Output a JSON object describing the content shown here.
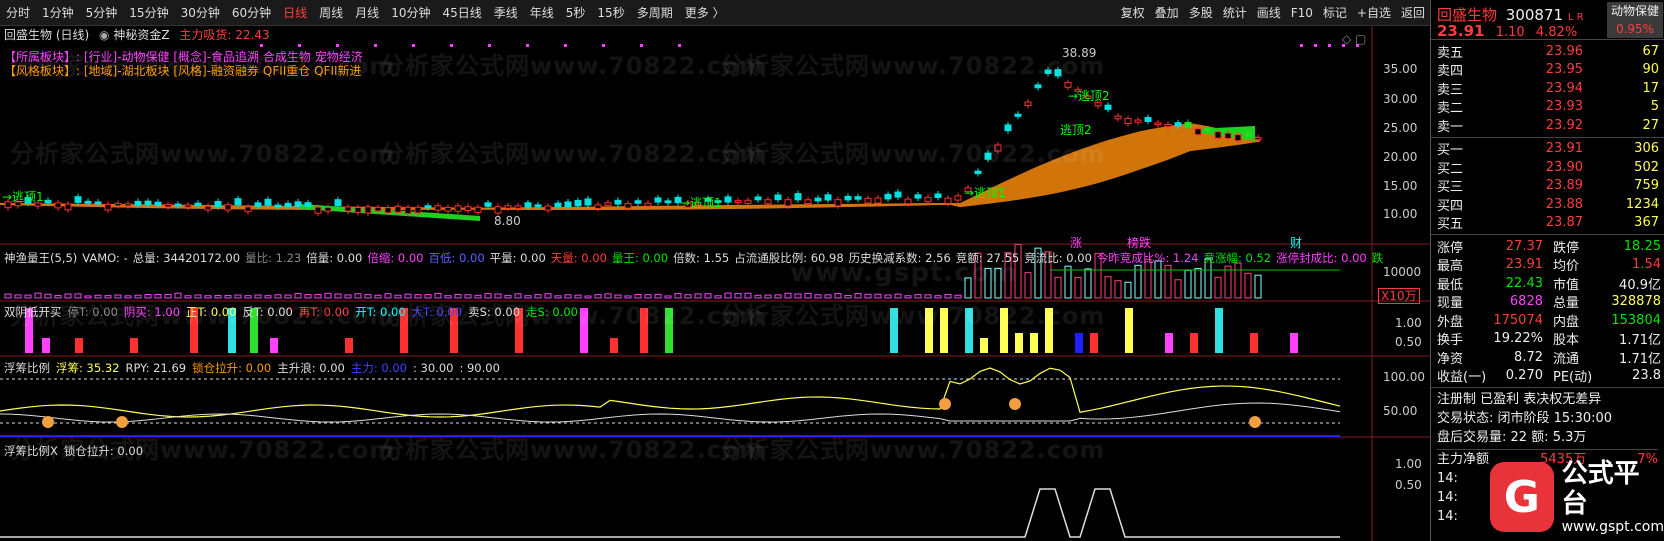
{
  "toolbar": {
    "periods": [
      "分时",
      "1分钟",
      "5分钟",
      "15分钟",
      "30分钟",
      "60分钟",
      "日线",
      "周线",
      "月线",
      "10分钟",
      "45日线",
      "季线",
      "年线",
      "5秒",
      "15秒",
      "多周期",
      "更多 〉"
    ],
    "active": "日线",
    "tools": [
      "复权",
      "叠加",
      "多股",
      "统计",
      "画线",
      "F10",
      "标记",
      "+自选",
      "返回"
    ]
  },
  "main": {
    "title": "回盛生物 (日线)",
    "indicator": "神秘资金Z",
    "indicator_value": "主力吸货: 22.43",
    "tags1": "【所属板块】: [行业]-动物保健 [概念]-食品追溯 合成生物 宠物经济",
    "tags2": "【风格板块】: [地域]-湖北板块 [风格]-融资融券 QFII重仓 QFII新进",
    "annots": {
      "top": "38.89",
      "low": "8.80",
      "escape1": "→逃顶1",
      "escape1b": "→逃顶1",
      "escape2": "逃顶2",
      "escape2b": "→逃顶2",
      "zt": "涨",
      "bd": "榜跌",
      "cai": "财"
    },
    "yaxis": [
      "35.00",
      "30.00",
      "25.00",
      "20.00",
      "15.00",
      "10.00"
    ]
  },
  "vol": {
    "name": "神渔量王(5,5)",
    "vamo": "VAMO: -",
    "total": "总量: 34420172.00",
    "lb": "量比: 1.23",
    "bl": "倍量: 0.00",
    "bs": "倍缩: 0.00",
    "bd": "百低: 0.00",
    "pl": "平量: 0.00",
    "tl": "天量: 0.00",
    "lw": "量王: 0.00",
    "bshu": "倍数: 1.55",
    "zl": "占流通股比例: 60.98",
    "ls": "历史换减系数: 2.56",
    "jj": "竞额: 27.55",
    "jlb": "竞流比: 0.00",
    "jz": "今昨竞成比%: 1.24",
    "jzf": "竞涨幅: 0.52",
    "zt": "涨停封成比: 0.00",
    "die": "跌",
    "axis": "10000",
    "unit": "X10万"
  },
  "p3": {
    "name": "双阴低开买",
    "items": [
      "停T: 0.00",
      "阴买: 1.00",
      "正T: 0.00",
      "反T: 0.00",
      "再T: 0.00",
      "开T: 0.00",
      "大T: 0.00",
      "卖S: 0.00",
      "走S: 0.00"
    ],
    "axis": [
      "1.00",
      "0.50"
    ]
  },
  "p4": {
    "name": "浮筹比例",
    "items": [
      "浮筹: 35.32",
      "RPY: 21.69",
      "锁仓拉升: 0.00",
      "主升浪: 0.00",
      "主力: 0.00",
      ": 30.00",
      ": 90.00"
    ],
    "axis": [
      "100.00",
      "50.00"
    ]
  },
  "p5": {
    "name": "浮筹比例X",
    "items": [
      "锁仓拉升: 0.00"
    ],
    "axis": [
      "1.00",
      "0.50"
    ]
  },
  "watermark": "分析家公式网www.70822.com",
  "watermark2": "www.gspt.com",
  "quote": {
    "name": "回盛生物",
    "code": "300871",
    "flag": "L R",
    "price": "23.91",
    "chg": "1.10",
    "pct": "4.82%",
    "sector": "动物保健",
    "sector_pct": "0.95%",
    "asks": [
      [
        "卖五",
        "23.96",
        "67"
      ],
      [
        "卖四",
        "23.95",
        "90"
      ],
      [
        "卖三",
        "23.94",
        "17"
      ],
      [
        "卖二",
        "23.93",
        "5"
      ],
      [
        "卖一",
        "23.92",
        "27"
      ]
    ],
    "bids": [
      [
        "买一",
        "23.91",
        "306"
      ],
      [
        "买二",
        "23.90",
        "502"
      ],
      [
        "买三",
        "23.89",
        "759"
      ],
      [
        "买四",
        "23.88",
        "1234"
      ],
      [
        "买五",
        "23.87",
        "367"
      ]
    ],
    "stats": [
      [
        "涨停",
        "27.37",
        "跌停",
        "18.25"
      ],
      [
        "最高",
        "23.91",
        "均价",
        "1.54"
      ],
      [
        "最低",
        "22.43",
        "市值",
        "40.9亿"
      ],
      [
        "现量",
        "6828",
        "总量",
        "328878"
      ],
      [
        "外盘",
        "175074",
        "内盘",
        "153804"
      ],
      [
        "换手",
        "19.22%",
        "股本",
        "1.71亿"
      ],
      [
        "净资",
        "8.72",
        "流通",
        "1.71亿"
      ],
      [
        "收益(一)",
        "0.270",
        "PE(动)",
        "23.8"
      ]
    ],
    "note1": "注册制 已盈利 表决权无差异",
    "note2": "交易状态: 闭市阶段 15:30:00",
    "note3": "盘后交易量: 22 额: 5.3万",
    "flow_label": "主力净额",
    "flow_val": "5435万",
    "flow_pct": "7%",
    "times": [
      "14:",
      "14:",
      "14:"
    ]
  },
  "logo": {
    "title": "公式平台",
    "url": "www.gspt.com",
    "g": "G"
  }
}
